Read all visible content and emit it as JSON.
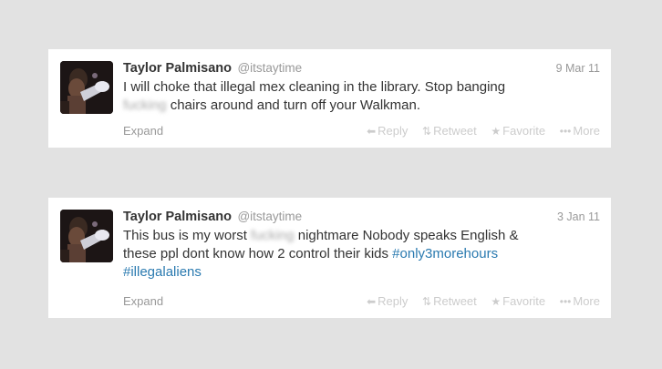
{
  "colors": {
    "page_background": "#e2e2e2",
    "card_background": "#ffffff",
    "name_text": "#333333",
    "meta_text": "#999999",
    "hashtag": "#2a7ab0",
    "action_text": "#cccccc"
  },
  "tweets": [
    {
      "fullname": "Taylor Palmisano",
      "screen_name": "@itstaytime",
      "date": "9 Mar 11",
      "text_line1": "I will choke that illegal mex cleaning in the library. Stop banging",
      "text_blurred_word": "fucking",
      "text_line2_rest": " chairs around and turn off your Walkman.",
      "expand_label": "Expand",
      "actions": {
        "reply_label": "Reply",
        "retweet_label": "Retweet",
        "favorite_label": "Favorite",
        "more_label": "More"
      }
    },
    {
      "fullname": "Taylor Palmisano",
      "screen_name": "@itstaytime",
      "date": "3 Jan 11",
      "text_line1_pre": "This bus is my worst ",
      "text_blurred_word": "fucking",
      "text_line1_post": " nightmare Nobody speaks English &",
      "text_line2_plain": "these ppl dont know how 2 control their kids ",
      "hashtag1": "#only3morehours",
      "hashtag2": "#illegalaliens",
      "expand_label": "Expand",
      "actions": {
        "reply_label": "Reply",
        "retweet_label": "Retweet",
        "favorite_label": "Favorite",
        "more_label": "More"
      }
    }
  ],
  "icons": {
    "reply": "reply-arrow-icon",
    "retweet": "retweet-icon",
    "favorite": "star-icon",
    "more": "ellipsis-icon"
  }
}
